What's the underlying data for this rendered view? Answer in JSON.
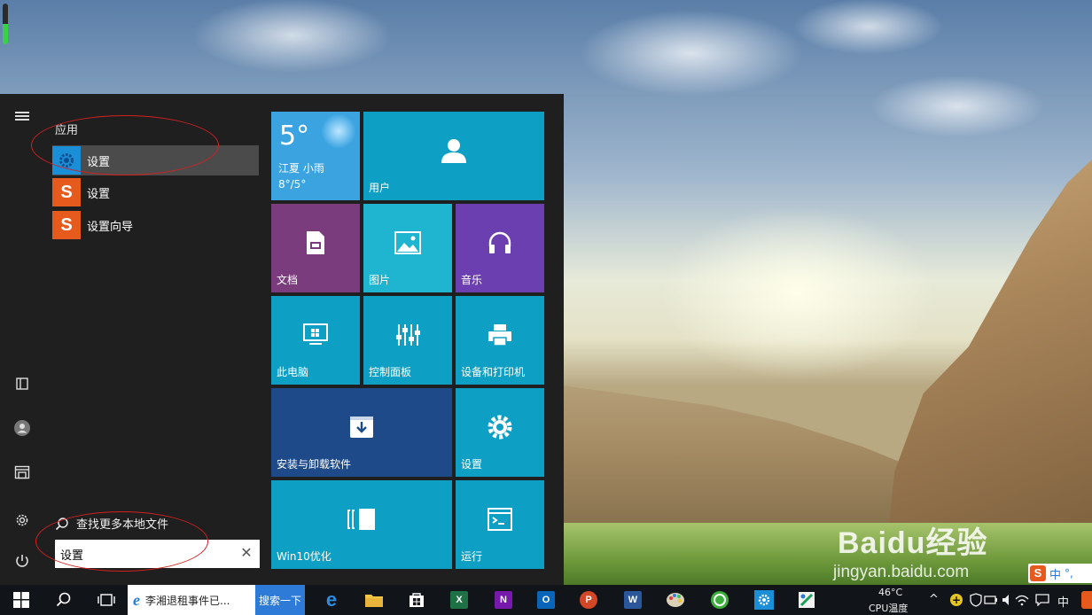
{
  "start_menu": {
    "section_label": "应用",
    "results": [
      {
        "label": "设置",
        "icon": "settings-gear-icon"
      },
      {
        "label": "设置",
        "icon": "sogou-icon"
      },
      {
        "label": "设置向导",
        "icon": "sogou-icon"
      }
    ],
    "search_more_label": "查找更多本地文件",
    "search_box_value": "设置"
  },
  "tiles": {
    "weather": {
      "temp": "5°",
      "location": "江夏 小雨",
      "range": "8°/5°"
    },
    "user": "用户",
    "documents": "文档",
    "pictures": "图片",
    "music": "音乐",
    "this_pc": "此电脑",
    "control_panel": "控制面板",
    "devices_printers": "设备和打印机",
    "install_uninstall": "安装与卸载软件",
    "settings": "设置",
    "win10_optimize": "Win10优化",
    "run": "运行"
  },
  "taskbar": {
    "ie_tab_title": "李湘退租事件已...",
    "search_web_button": "搜索一下",
    "cpu_temp": "46°C",
    "cpu_label": "CPU温度",
    "ime_label": "中",
    "ime_badge": "中",
    "ime_punct": "°,"
  },
  "watermark": {
    "brand": "Baidu经验",
    "url": "jingyan.baidu.com"
  },
  "colors": {
    "tile_blue": "#0ea0c4",
    "tile_purple_dark": "#7b3c7e",
    "tile_purple": "#6b3fb0",
    "tile_navy": "#1e4a8a",
    "tile_weather": "#3aa3e0",
    "menu_bg": "#1f1f1f",
    "annotation": "#d42020"
  }
}
